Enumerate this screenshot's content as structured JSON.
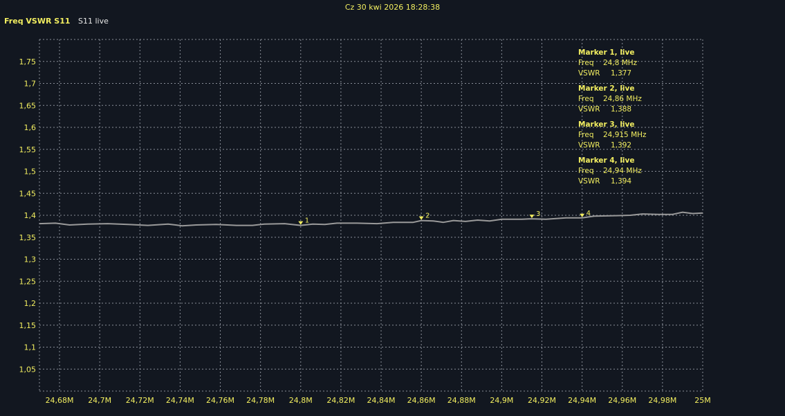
{
  "timestamp": "Cz 30 kwi 2026 18:28:38",
  "header": {
    "title": "Freq VSWR S11",
    "trace": "S11 live"
  },
  "colors": {
    "background": "#121720",
    "text": "#f2ee60",
    "grid": "#8a8f99",
    "trace": "#9a9a9a",
    "marker": "#f2ee60"
  },
  "chart_data": {
    "type": "line",
    "title": "Freq VSWR S11",
    "xlabel": "",
    "ylabel": "",
    "xlim": [
      24.67,
      25.0
    ],
    "ylim": [
      1.0,
      1.8
    ],
    "grid": true,
    "x_ticks": [
      24.68,
      24.7,
      24.72,
      24.74,
      24.76,
      24.78,
      24.8,
      24.82,
      24.84,
      24.86,
      24.88,
      24.9,
      24.92,
      24.94,
      24.96,
      24.98,
      25.0
    ],
    "x_tick_labels": [
      "24,68M",
      "24,7M",
      "24,72M",
      "24,74M",
      "24,76M",
      "24,78M",
      "24,8M",
      "24,82M",
      "24,84M",
      "24,86M",
      "24,88M",
      "24,9M",
      "24,92M",
      "24,94M",
      "24,96M",
      "24,98M",
      "25M"
    ],
    "y_ticks": [
      1.05,
      1.1,
      1.15,
      1.2,
      1.25,
      1.3,
      1.35,
      1.4,
      1.45,
      1.5,
      1.55,
      1.6,
      1.65,
      1.7,
      1.75
    ],
    "y_tick_labels": [
      "1,05",
      "1,1",
      "1,15",
      "1,2",
      "1,25",
      "1,3",
      "1,35",
      "1,4",
      "1,45",
      "1,5",
      "1,55",
      "1,6",
      "1,65",
      "1,7",
      "1,75"
    ],
    "series": [
      {
        "x": [
          24.67,
          24.678,
          24.685,
          24.694,
          24.704,
          24.714,
          24.724,
          24.734,
          24.741,
          24.748,
          24.758,
          24.768,
          24.776,
          24.782,
          24.792,
          24.8,
          24.806,
          24.812,
          24.818,
          24.828,
          24.838,
          24.846,
          24.856,
          24.86,
          24.866,
          24.871,
          24.876,
          24.882,
          24.888,
          24.894,
          24.9,
          24.91,
          24.915,
          24.922,
          24.932,
          24.94,
          24.946,
          24.956,
          24.964,
          24.97,
          24.978,
          24.985,
          24.99,
          24.995,
          25.0
        ],
        "y": [
          1.381,
          1.382,
          1.378,
          1.38,
          1.381,
          1.379,
          1.377,
          1.38,
          1.376,
          1.378,
          1.379,
          1.377,
          1.377,
          1.38,
          1.381,
          1.377,
          1.38,
          1.379,
          1.382,
          1.382,
          1.381,
          1.384,
          1.384,
          1.388,
          1.387,
          1.384,
          1.388,
          1.386,
          1.389,
          1.387,
          1.391,
          1.391,
          1.392,
          1.391,
          1.394,
          1.394,
          1.398,
          1.399,
          1.4,
          1.403,
          1.402,
          1.402,
          1.407,
          1.404,
          1.405
        ]
      }
    ],
    "markers": [
      {
        "label": "1",
        "freq": 24.8,
        "vswr": 1.377
      },
      {
        "label": "2",
        "freq": 24.86,
        "vswr": 1.388
      },
      {
        "label": "3",
        "freq": 24.915,
        "vswr": 1.392
      },
      {
        "label": "4",
        "freq": 24.94,
        "vswr": 1.394
      }
    ]
  },
  "marker_panel": [
    {
      "title": "Marker 1, live",
      "freq_label": "Freq",
      "freq_value": "24,8 MHz",
      "vswr_label": "VSWR",
      "vswr_value": "1,377"
    },
    {
      "title": "Marker 2, live",
      "freq_label": "Freq",
      "freq_value": "24,86 MHz",
      "vswr_label": "VSWR",
      "vswr_value": "1,388"
    },
    {
      "title": "Marker 3, live",
      "freq_label": "Freq",
      "freq_value": "24,915 MHz",
      "vswr_label": "VSWR",
      "vswr_value": "1,392"
    },
    {
      "title": "Marker 4, live",
      "freq_label": "Freq",
      "freq_value": "24,94 MHz",
      "vswr_label": "VSWR",
      "vswr_value": "1,394"
    }
  ]
}
